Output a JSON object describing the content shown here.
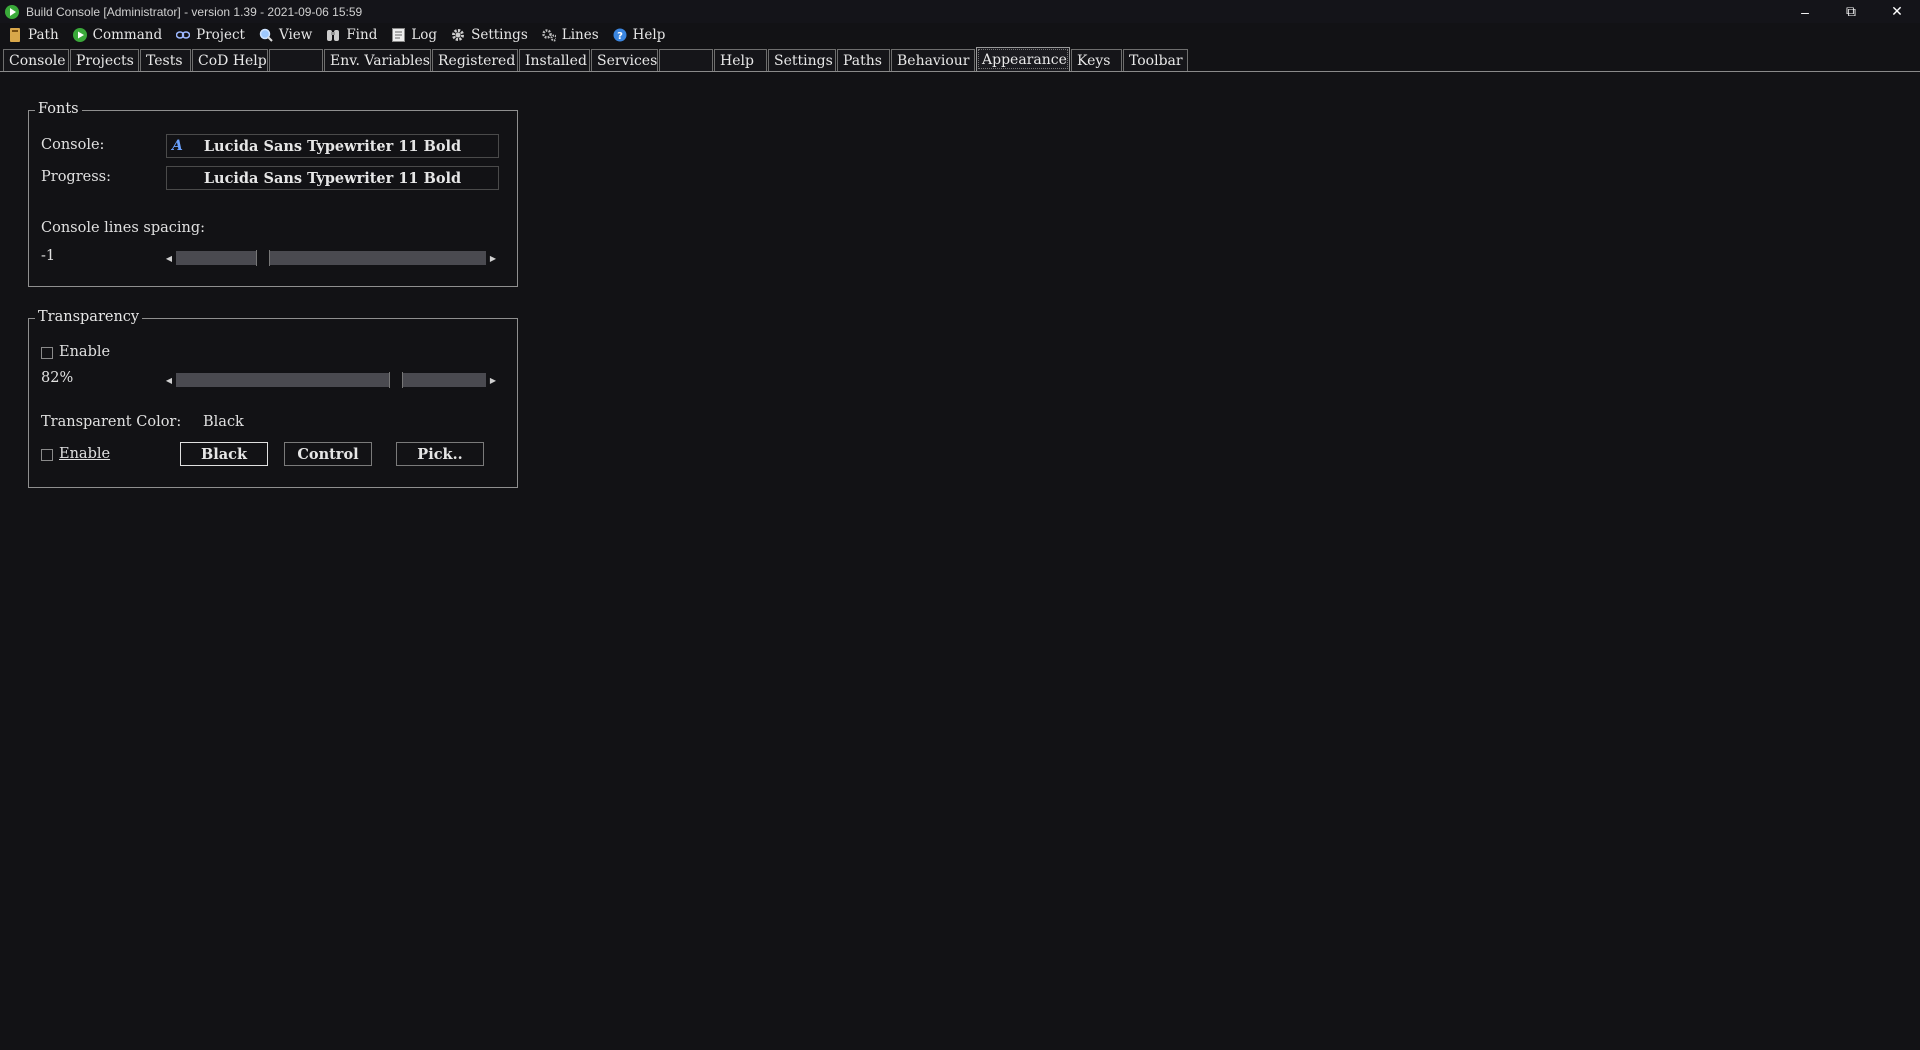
{
  "window": {
    "title": "Build Console [Administrator] - version 1.39 - 2021-09-06 15:59",
    "minimize": "–",
    "maximize": "⧉",
    "close": "✕"
  },
  "menu": [
    {
      "label": "Path",
      "icon": "book-icon"
    },
    {
      "label": "Command",
      "icon": "play-icon"
    },
    {
      "label": "Project",
      "icon": "link-icon"
    },
    {
      "label": "View",
      "icon": "magnifier-icon"
    },
    {
      "label": "Find",
      "icon": "binoculars-icon"
    },
    {
      "label": "Log",
      "icon": "log-icon"
    },
    {
      "label": "Settings",
      "icon": "gear-icon"
    },
    {
      "label": "Lines",
      "icon": "gears-icon"
    },
    {
      "label": "Help",
      "icon": "help-icon"
    }
  ],
  "tabs": [
    {
      "label": "Console"
    },
    {
      "label": "Projects"
    },
    {
      "label": "Tests"
    },
    {
      "label": "CoD Help"
    },
    {
      "label": ""
    },
    {
      "label": "Env. Variables"
    },
    {
      "label": "Registered"
    },
    {
      "label": "Installed"
    },
    {
      "label": "Services"
    },
    {
      "label": ""
    },
    {
      "label": "Help"
    },
    {
      "label": "Settings"
    },
    {
      "label": "Paths"
    },
    {
      "label": "Behaviour"
    },
    {
      "label": "Appearance",
      "active": true
    },
    {
      "label": "Keys"
    },
    {
      "label": "Toolbar"
    }
  ],
  "fonts": {
    "title": "Fonts",
    "console_label": "Console:",
    "console_value": "Lucida Sans Typewriter 11 Bold",
    "progress_label": "Progress:",
    "progress_value": "Lucida Sans Typewriter 11 Bold",
    "spacing_label": "Console lines spacing:",
    "spacing_value": "-1",
    "spacing_level": 0.27
  },
  "transparency": {
    "title": "Transparency",
    "enable_label": "Enable",
    "enabled": false,
    "percent_text": "82%",
    "level": 0.72,
    "color_label": "Transparent Color:",
    "color_value": "Black",
    "color_enable_label": "Enable",
    "color_enabled": false,
    "btn_black": "Black",
    "btn_control": "Control",
    "btn_pick": "Pick.."
  }
}
